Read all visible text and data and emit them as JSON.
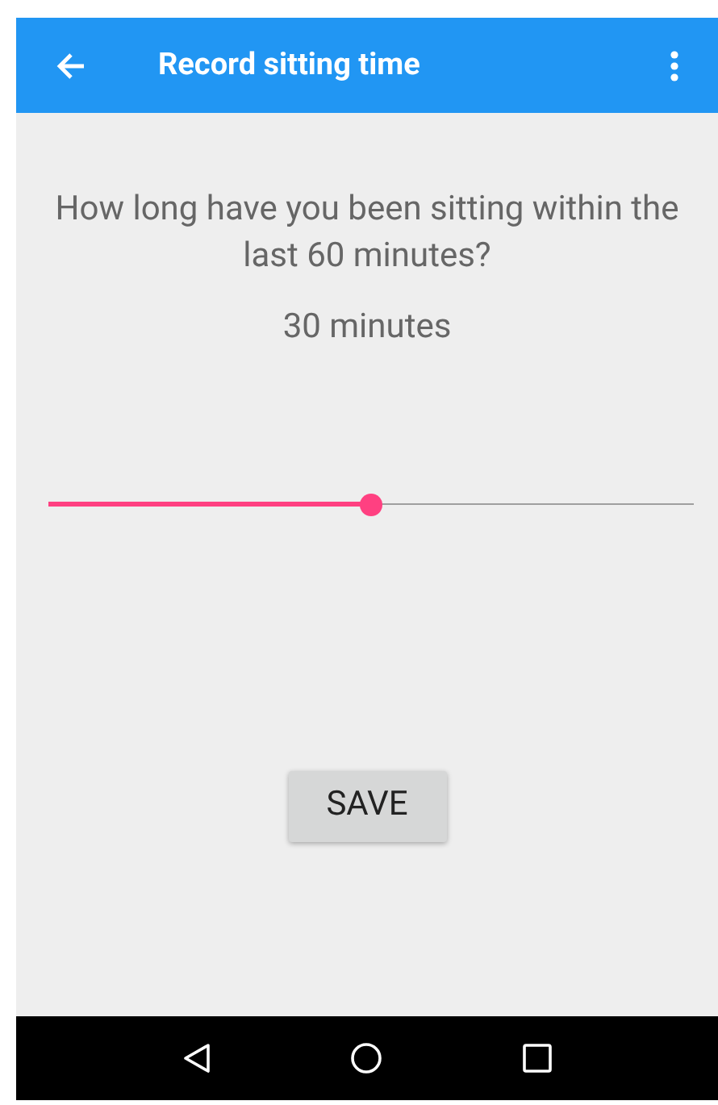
{
  "app_bar": {
    "title": "Record sitting time"
  },
  "question": "How long have you been sitting within the last 60 minutes?",
  "reading": "30 minutes",
  "slider": {
    "level": 0.5
  },
  "buttons": [
    {
      "label": "SAVE"
    }
  ]
}
